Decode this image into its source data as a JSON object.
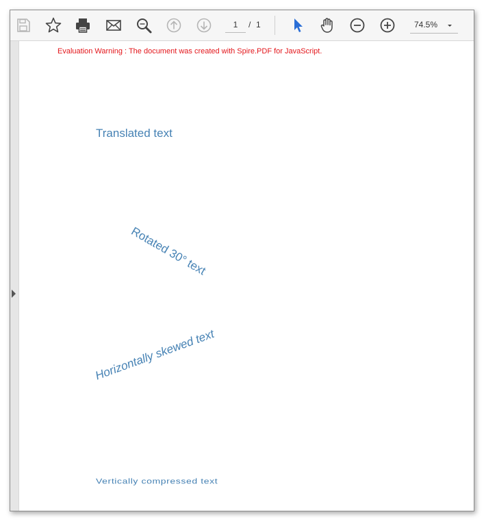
{
  "toolbar": {
    "icons": {
      "save": "save-icon",
      "bookmark": "star-icon",
      "print": "printer-icon",
      "email": "envelope-icon",
      "find": "search-icon",
      "prev_page": "arrow-up-circle-icon",
      "next_page": "arrow-down-circle-icon",
      "select_tool": "cursor-icon",
      "hand_tool": "hand-icon",
      "zoom_out": "minus-circle-icon",
      "zoom_in": "plus-circle-icon"
    },
    "page_current": "1",
    "page_separator": "/",
    "page_total": "1",
    "zoom_value": "74.5%",
    "accent_color": "#2a6ed6"
  },
  "document": {
    "warning": "Evaluation Warning : The document was created with Spire.PDF for JavaScript.",
    "warning_color": "#e3151a",
    "text_color": "#4682b4",
    "texts": {
      "translated": "Translated text",
      "rotated": "Rotated 30° text",
      "skewed": "Horizontally skewed text",
      "compressed": "Vertically compressed text"
    }
  }
}
